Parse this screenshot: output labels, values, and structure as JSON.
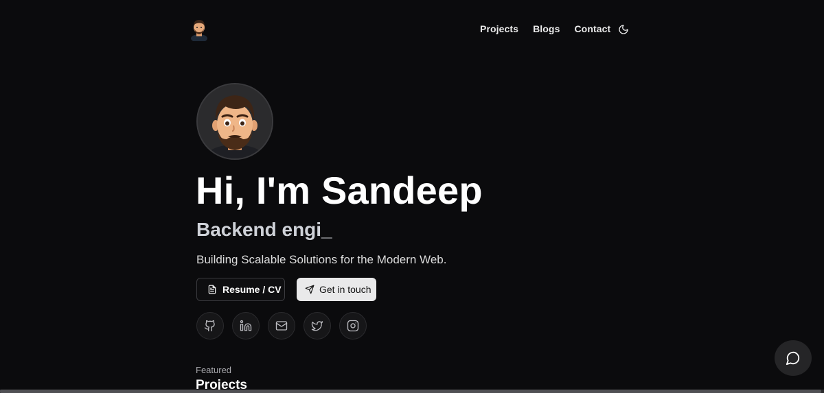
{
  "nav": {
    "links": [
      {
        "label": "Projects"
      },
      {
        "label": "Blogs"
      },
      {
        "label": "Contact"
      }
    ],
    "theme_icon": "moon-icon",
    "avatar_icon": "avatar"
  },
  "hero": {
    "title": "Hi, I'm Sandeep",
    "role": "Backend engi_",
    "tagline": "Building Scalable Solutions for the Modern Web.",
    "buttons": {
      "resume": "Resume / CV",
      "contact": "Get in touch"
    },
    "socials": [
      "github-icon",
      "linkedin-icon",
      "mail-icon",
      "twitter-icon",
      "instagram-icon"
    ]
  },
  "featured": {
    "label": "Featured",
    "title": "Projects"
  },
  "chat": {
    "icon": "chat-bubble-icon"
  },
  "colors": {
    "background": "#0b0b0d",
    "button_light": "#e9e9ea",
    "role_text": "#cfd2d8"
  }
}
